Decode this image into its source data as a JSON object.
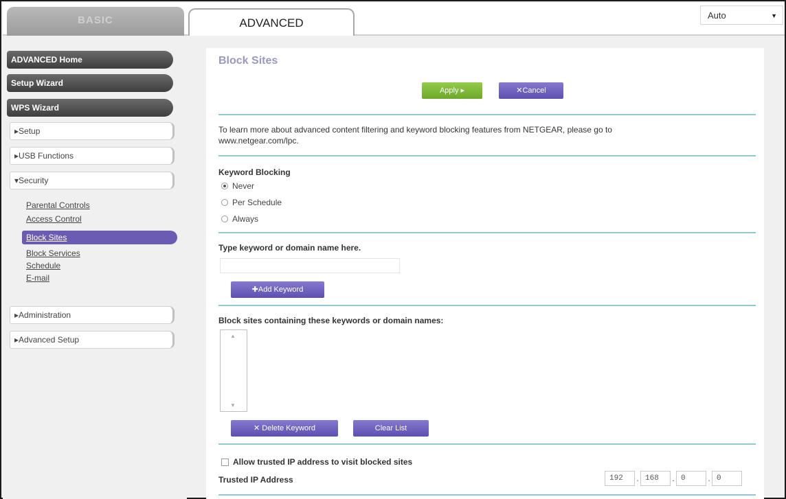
{
  "tabs": {
    "basic": "BASIC",
    "advanced": "ADVANCED"
  },
  "language_select": {
    "value": "Auto"
  },
  "sidebar": {
    "main_items": [
      "ADVANCED Home",
      "Setup Wizard",
      "WPS Wizard"
    ],
    "sections": {
      "setup": "▸Setup",
      "usb": "▸USB Functions",
      "security": "▾Security",
      "administration": "▸Administration",
      "advanced_setup": "▸Advanced Setup"
    },
    "security_items": {
      "parental_controls": "Parental Controls",
      "access_control": "Access Control",
      "block_sites": "Block Sites",
      "block_services": "Block Services",
      "schedule": "Schedule",
      "email": "E-mail"
    }
  },
  "main": {
    "title": "Block Sites",
    "apply_label": "Apply ▸",
    "cancel_label": "✕Cancel",
    "info_text_line1": "To learn more about advanced content filtering and keyword blocking features from NETGEAR, please go to",
    "info_text_line2": "www.netgear.com/lpc.",
    "keyword_blocking": {
      "heading": "Keyword Blocking",
      "options": [
        "Never",
        "Per Schedule",
        "Always"
      ],
      "selected": "Never"
    },
    "keyword_input_label": "Type keyword or domain name here.",
    "keyword_input_value": "",
    "add_keyword_label": "✚Add Keyword",
    "block_list_label": "Block sites containing these keywords or domain names:",
    "block_list_items": [],
    "delete_keyword_label": "✕ Delete Keyword",
    "clear_list_label": "Clear List",
    "allow_trusted_label": "Allow trusted IP address to visit blocked sites",
    "trusted_ip_label": "Trusted IP Address",
    "trusted_ip": [
      "192",
      "168",
      "0",
      "0"
    ]
  },
  "colors": {
    "accent_purple": "#6b5bb3",
    "apply_green": "#7cb83a",
    "divider_teal": "#8fc9d8",
    "title_lavender": "#9a97c4"
  }
}
